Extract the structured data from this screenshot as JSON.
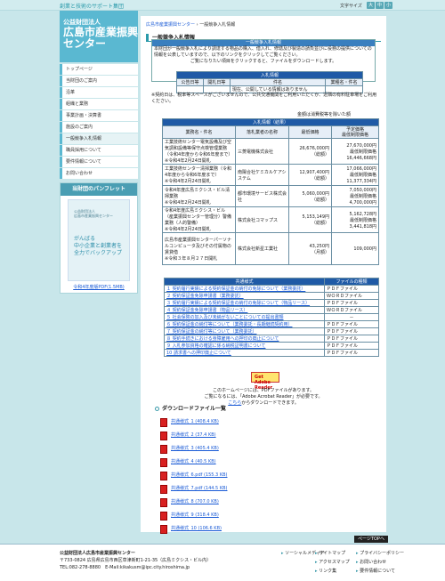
{
  "tagline": "創業と技術のサポート集団",
  "font_size_label": "文字サイズ",
  "font_sizes": [
    "大",
    "中",
    "小"
  ],
  "logo": {
    "org": "公益財団法人",
    "name": "広島市産業振興センター"
  },
  "nav": [
    "トップページ",
    "当財団のご案内",
    "沿革",
    "組織と業務",
    "事業計画・決算書",
    "施設のご案内",
    "一般競争入札情報",
    "職員採用について",
    "要件情報について",
    "お問い合わせ"
  ],
  "pamphlet": {
    "title": "当財団のパンフレット",
    "cover_small": "公益財団法人\n広島市産業振興センター",
    "cover_big": "がんばる\n中小企業と創業者を\n全力でバックアップ",
    "link": "令和4年度版PDF(1.5MB)"
  },
  "breadcrumb": {
    "home": "広島市産業振興センター",
    "sep": "›",
    "current": "一般競争入札情報"
  },
  "heading": "一般競争入札情報",
  "intro": {
    "head": "一般競争入札情報",
    "lines": [
      "本財団が一般競争入札により調達する物品の購入、借入れ、修繕及び製造の請負並びに役務の提供についての",
      "情報を公表していますので、以下のリンクをクリックしてご覧ください。",
      "ご覧になりたい項目をクリックすると、ファイルをダウンロードします。"
    ]
  },
  "nyusatsu": {
    "caption": "入札情報",
    "headers": [
      "公告日等",
      "開札日等",
      "件名",
      "業種名・件名"
    ],
    "row": [
      "",
      "",
      "現在、公開している情報はありません",
      ""
    ]
  },
  "note": "※契約日は、税率等スペースがございませんので、公共交通機関をご利用いただくか、近隣の有料駐車場をご利用ください。",
  "amount_note": "金額は消費税等を除いた額",
  "results": {
    "caption": "入札情報（結果）",
    "headers": [
      "業務名・件名",
      "落札業者の名称",
      "最低価格",
      "予定価格\n最低制限価格"
    ],
    "rows": [
      {
        "name": "工業技術センター電気設備及び空気調和設備等保守点検管理業務（令和4年度から令和6年度まで）",
        "note": "※令和4年2月24日開札",
        "vendor": "三菱電機株式会社",
        "bid": "26,676,000円",
        "bidnote": "（総額）",
        "p1": "27,670,000円",
        "p1l": "最低制限価格",
        "p2": "16,446,668円"
      },
      {
        "name": "工業技術センター清掃業務（令和4年度から令和6年度まで）",
        "note": "※令和4年2月24日開札",
        "vendor": "南陽合社ケミカルケアシステム",
        "bid": "12,907,400円",
        "bidnote": "（総額）",
        "p1": "17,066,000円",
        "p1l": "最低制限価格",
        "p2": "11,377,334円"
      },
      {
        "name": "令和4年度広島ミクシス・ビル清掃業務",
        "note": "※令和4年2月24日開札",
        "vendor": "都市環境サービス株式会社",
        "bid": "5,060,000円",
        "bidnote": "（総額）",
        "p1": "7,050,000円",
        "p1l": "最低制限価格",
        "p2": "4,700,000円"
      },
      {
        "name": "令和4年度広島ミクシス・ビル（産業振興センター管理分）警備業務（人的警備）",
        "note": "※令和4年2月24日開札",
        "vendor": "株式会社コマップス",
        "bid": "5,153,149円",
        "bidnote": "（総額）",
        "p1": "5,162,728円",
        "p1l": "最低制限価格",
        "p2": "3,441,818円"
      },
      {
        "name": "広島市産業振興センターパーソナルコンピュータ及びその付属物の賃貸借",
        "note": "※令和３年８月２７日開札",
        "vendor": "株式会社新星工業社",
        "bid": "43,250円",
        "bidnote": "（月額）",
        "p1": "109,000円",
        "p1l": "",
        "p2": ""
      }
    ]
  },
  "common": {
    "caption": "共通様式",
    "col2": "ファイルの種類",
    "rows": [
      {
        "name": "１ 契約履行実績による契約保証金の納付の免除について（業務委託）",
        "type": "ＰＤＦファイル"
      },
      {
        "name": "２ 契約保証金免除申請書（業務委託）",
        "type": "ＷＯＲＤファイル"
      },
      {
        "name": "３ 契約履行実績による契約保証金の納付の免除について（物品リース）",
        "type": "ＰＤＦファイル"
      },
      {
        "name": "４ 契約保証金免除申請書（物品リース）",
        "type": "ＷＯＲＤファイル"
      },
      {
        "name": "５ 社会保険の加入及び未納がないことについての提出書類",
        "type": "－"
      },
      {
        "name": "６ 契約保証金の納付等について（業務委託・長期継続契約用）",
        "type": "ＰＤＦファイル"
      },
      {
        "name": "７ 契約保証金の納付等について（業務委託）",
        "type": "ＰＤＦファイル"
      },
      {
        "name": "８ 契約手続きにおける身障雇用への押印の廃止について",
        "type": "ＰＤＦファイル"
      },
      {
        "name": "９ 入札参加資格の確認に係る納税証明書について",
        "type": "ＰＤＦファイル"
      },
      {
        "name": "10 請求書への押印廃止について",
        "type": "ＰＤＦファイル"
      }
    ]
  },
  "adobe": {
    "badge": "Get Adobe Reader",
    "lines": [
      "このホームページには、PDFファイルがあります。",
      "ご覧になるには、「Adobe Acrobat Reader」が必要です。"
    ],
    "here": "こちら",
    "after": "からダウンロードできます。"
  },
  "download_title": "ダウンロードファイル一覧",
  "files": [
    "共通様式_1 (408.4 KB)",
    "共通様式_2 (37.4 KB)",
    "共通様式_3 (405.4 KB)",
    "共通様式_4 (40.5 KB)",
    "共通様式_6.pdf (155.3 KB)",
    "共通様式_7.pdf (144.5 KB)",
    "共通様式_8 (707.0 KB)",
    "共通様式_9 (318.4 KB)",
    "共通様式_10 (106.6 KB)"
  ],
  "pagetop": "ページTOPへ",
  "footer": {
    "org": "公益財団法人広島市産業振興センター",
    "address": "〒733-0824 広島県広島市西区草津新町1-21-35（広島ミクシス・ビル内）",
    "contact": "TEL:082-278-8880　E-Mail:kikakusm@ipc.city.hiroshima.jp",
    "col1": [
      "ソーシャルメディア"
    ],
    "col2": [
      "サイトマップ",
      "アクセスマップ",
      "リンク集"
    ],
    "col3": [
      "プライバシーポリシー",
      "お問い合わせ",
      "要件情報について"
    ]
  }
}
